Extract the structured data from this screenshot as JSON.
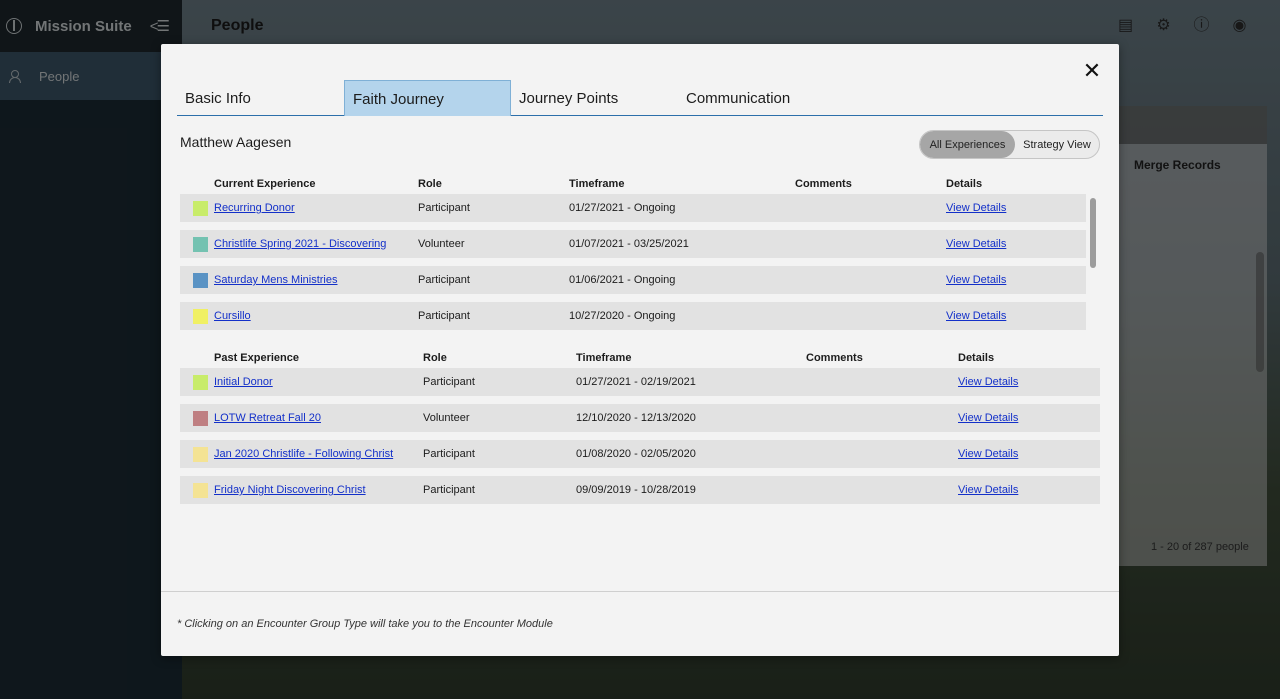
{
  "app": {
    "name": "Mission Suite"
  },
  "sidebar": {
    "items": [
      {
        "label": "People"
      }
    ]
  },
  "header": {
    "title": "People"
  },
  "background": {
    "merge_label": "Merge Records",
    "pagination": "1 - 20 of 287 people"
  },
  "modal": {
    "tabs": [
      {
        "label": "Basic Info"
      },
      {
        "label": "Faith Journey"
      },
      {
        "label": "Journey Points"
      },
      {
        "label": "Communication"
      }
    ],
    "person_name": "Matthew Aagesen",
    "view_toggle": {
      "active": "All Experiences",
      "other": "Strategy View"
    },
    "current": {
      "headers": [
        "Current Experience",
        "Role",
        "Timeframe",
        "Comments",
        "Details"
      ],
      "rows": [
        {
          "name": "Recurring Donor",
          "role": "Participant",
          "timeframe": "01/27/2021 - Ongoing",
          "comments": "",
          "details": "View Details",
          "color": "#c8ec6a"
        },
        {
          "name": "Christlife Spring 2021 - Discovering",
          "role": "Volunteer",
          "timeframe": "01/07/2021 - 03/25/2021",
          "comments": "",
          "details": "View Details",
          "color": "#74c2b1"
        },
        {
          "name": "Saturday Mens Ministries",
          "role": "Participant",
          "timeframe": "01/06/2021 - Ongoing",
          "comments": "",
          "details": "View Details",
          "color": "#5a93c4"
        },
        {
          "name": "Cursillo",
          "role": "Participant",
          "timeframe": "10/27/2020 - Ongoing",
          "comments": "",
          "details": "View Details",
          "color": "#f0f064"
        }
      ]
    },
    "past": {
      "headers": [
        "Past Experience",
        "Role",
        "Timeframe",
        "Comments",
        "Details"
      ],
      "rows": [
        {
          "name": "Initial Donor",
          "role": "Participant",
          "timeframe": "01/27/2021 - 02/19/2021",
          "comments": "",
          "details": "View Details",
          "color": "#c8ec6a"
        },
        {
          "name": "LOTW Retreat Fall 20",
          "role": "Volunteer",
          "timeframe": "12/10/2020 - 12/13/2020",
          "comments": "",
          "details": "View Details",
          "color": "#bf7f82"
        },
        {
          "name": "Jan 2020 Christlife - Following Christ",
          "role": "Participant",
          "timeframe": "01/08/2020 - 02/05/2020",
          "comments": "",
          "details": "View Details",
          "color": "#f4e394"
        },
        {
          "name": "Friday Night Discovering Christ",
          "role": "Participant",
          "timeframe": "09/09/2019 - 10/28/2019",
          "comments": "",
          "details": "View Details",
          "color": "#f4e394"
        }
      ]
    },
    "footnote": "* Clicking on an Encounter Group Type will take you to the Encounter Module",
    "close_symbol": "✕"
  }
}
